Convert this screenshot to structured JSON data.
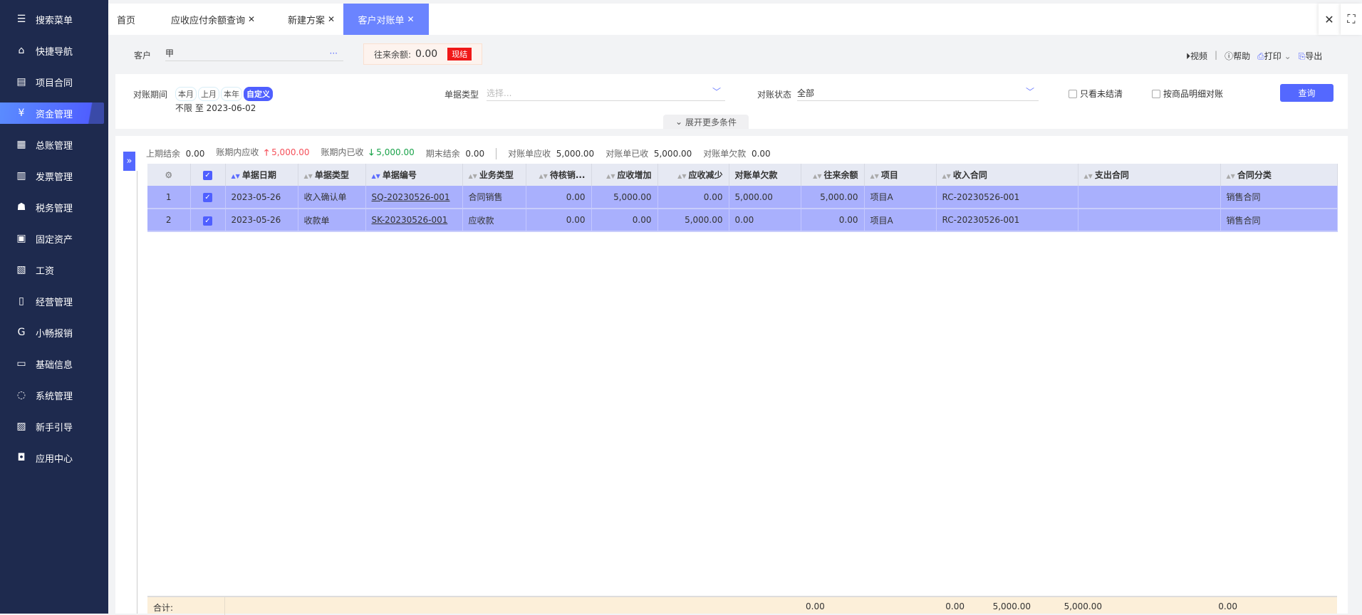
{
  "sidebar": {
    "items": [
      {
        "label": "搜索菜单",
        "icon": "search-menu-icon"
      },
      {
        "label": "快捷导航",
        "icon": "home-icon"
      },
      {
        "label": "项目合同",
        "icon": "contract-icon"
      },
      {
        "label": "资金管理",
        "icon": "money-bag-icon",
        "active": true
      },
      {
        "label": "总账管理",
        "icon": "ledger-icon"
      },
      {
        "label": "发票管理",
        "icon": "invoice-icon"
      },
      {
        "label": "税务管理",
        "icon": "tax-icon"
      },
      {
        "label": "固定资产",
        "icon": "building-icon"
      },
      {
        "label": "工资",
        "icon": "salary-icon"
      },
      {
        "label": "经营管理",
        "icon": "clipboard-icon"
      },
      {
        "label": "小畅报销",
        "icon": "reimburse-icon"
      },
      {
        "label": "基础信息",
        "icon": "info-card-icon"
      },
      {
        "label": "系统管理",
        "icon": "system-icon"
      },
      {
        "label": "新手引导",
        "icon": "guide-icon"
      },
      {
        "label": "应用中心",
        "icon": "app-center-icon"
      }
    ]
  },
  "tabs": [
    {
      "label": "首页"
    },
    {
      "label": "应收应付余额查询",
      "closable": true
    },
    {
      "label": "新建方案",
      "closable": true
    },
    {
      "label": "客户对账单",
      "closable": true,
      "active": true
    }
  ],
  "customer": {
    "label": "客户",
    "value": "甲",
    "more": "···",
    "balance_label": "往来余额:",
    "balance_value": "0.00",
    "settle_label": "现结"
  },
  "tools": {
    "video": "视频",
    "help": "帮助",
    "print": "打印",
    "export": "导出"
  },
  "filters": {
    "period_label": "对账期间",
    "period_options": [
      "本月",
      "上月",
      "本年",
      "自定义"
    ],
    "period_selected": "自定义",
    "period_range": "不限 至 2023-06-02",
    "doc_type_label": "单据类型",
    "doc_type_placeholder": "选择...",
    "status_label": "对账状态",
    "status_value": "全部",
    "only_unsettled": "只看未结清",
    "by_goods": "按商品明细对账",
    "query": "查询",
    "expand_more": "展开更多条件"
  },
  "summary": [
    {
      "label": "上期结余",
      "value": "0.00"
    },
    {
      "label": "账期内应收",
      "value": "5,000.00",
      "trend": "up",
      "color": "#f5505a"
    },
    {
      "label": "账期内已收",
      "value": "5,000.00",
      "trend": "down",
      "color": "#1aa34a"
    },
    {
      "label": "期末结余",
      "value": "0.00"
    },
    {
      "label": "对账单应收",
      "value": "5,000.00"
    },
    {
      "label": "对账单已收",
      "value": "5,000.00"
    },
    {
      "label": "对账单欠款",
      "value": "0.00"
    }
  ],
  "table": {
    "columns": [
      "",
      "",
      "单据日期",
      "单据类型",
      "单据编号",
      "业务类型",
      "待核销...",
      "应收增加",
      "应收减少",
      "对账单欠款",
      "往来余额",
      "项目",
      "收入合同",
      "支出合同",
      "合同分类"
    ],
    "rows": [
      [
        "1",
        "",
        "2023-05-26",
        "收入确认单",
        "SQ-20230526-001",
        "合同销售",
        "0.00",
        "5,000.00",
        "0.00",
        "5,000.00",
        "5,000.00",
        "项目A",
        "RC-20230526-001",
        "",
        "销售合同"
      ],
      [
        "2",
        "",
        "2023-05-26",
        "收款单",
        "SK-20230526-001",
        "应收款",
        "0.00",
        "0.00",
        "5,000.00",
        "0.00",
        "0.00",
        "项目A",
        "RC-20230526-001",
        "",
        "销售合同"
      ]
    ],
    "footer": {
      "label": "合计:",
      "values": [
        "0.00",
        "5,000.00",
        "5,000.00",
        "0.00",
        "0.00"
      ]
    }
  }
}
